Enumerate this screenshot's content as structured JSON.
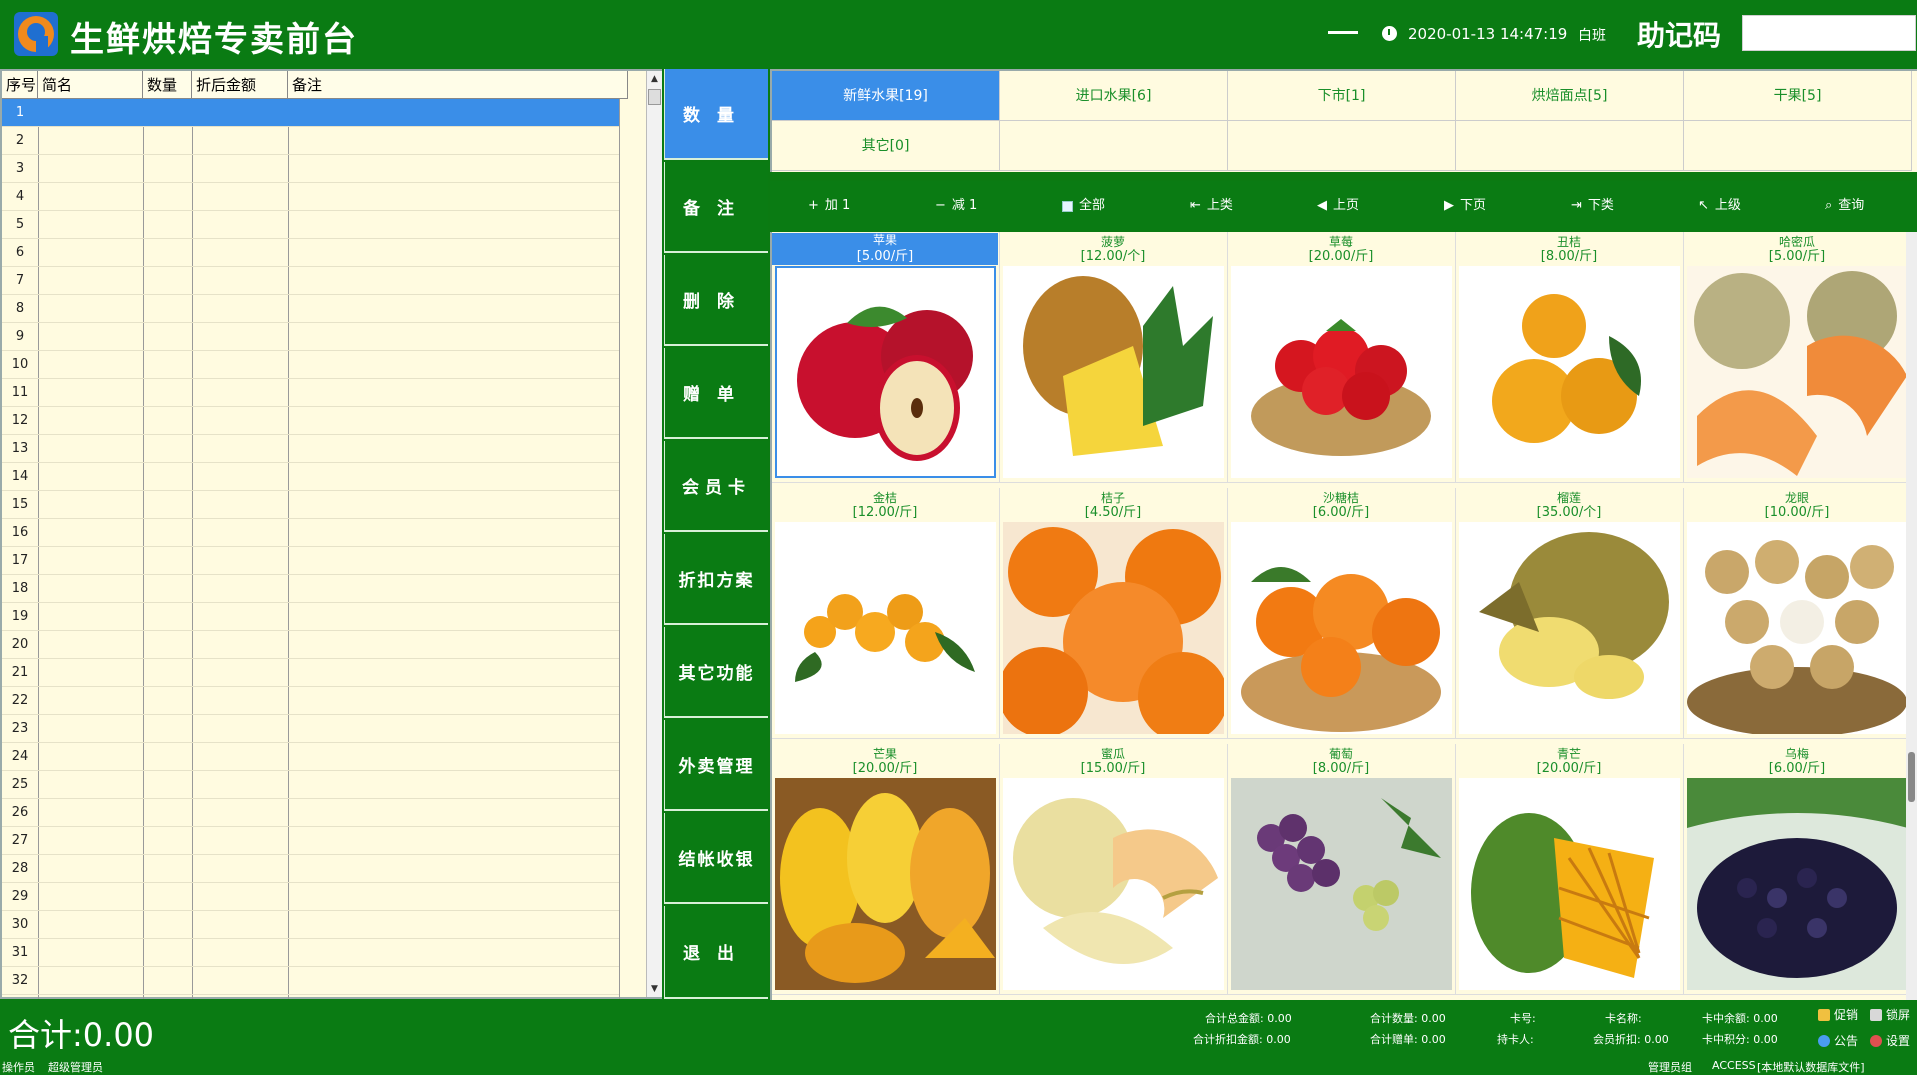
{
  "window": {
    "title": "生鲜烘焙专卖前台",
    "datetime": "2020-01-13 14:47:19",
    "shift": "白班",
    "mnemonic_label": "助记码",
    "mnemonic_value": ""
  },
  "order_table": {
    "columns": [
      "序号",
      "简名",
      "数量",
      "折后金额",
      "备注"
    ],
    "row_numbers": [
      "1",
      "2",
      "3",
      "4",
      "5",
      "6",
      "7",
      "8",
      "9",
      "10",
      "11",
      "12",
      "13",
      "14",
      "15",
      "16",
      "17",
      "18",
      "19",
      "20",
      "21",
      "22",
      "23",
      "24",
      "25",
      "26",
      "27",
      "28",
      "29",
      "30",
      "31",
      "32"
    ],
    "selected_row": 1
  },
  "function_buttons": [
    "数　量",
    "备　注",
    "删　除",
    "赠　单",
    "会员卡",
    "折扣方案",
    "其它功能",
    "外卖管理",
    "结帐收银",
    "退　出"
  ],
  "categories": [
    "新鲜水果[19]",
    "进口水果[6]",
    "下市[1]",
    "烘焙面点[5]",
    "干果[5]",
    "其它[0]"
  ],
  "selected_category": 0,
  "toolbar": [
    "加 1",
    "减 1",
    "全部",
    "上类",
    "上页",
    "下页",
    "下类",
    "上级",
    "查询"
  ],
  "products": [
    {
      "name": "苹果",
      "price": "[5.00/斤]",
      "icon": "apple"
    },
    {
      "name": "菠萝",
      "price": "[12.00/个]",
      "icon": "pineapple"
    },
    {
      "name": "草莓",
      "price": "[20.00/斤]",
      "icon": "strawberry"
    },
    {
      "name": "丑桔",
      "price": "[8.00/斤]",
      "icon": "ugli"
    },
    {
      "name": "哈密瓜",
      "price": "[5.00/斤]",
      "icon": "cantaloupe"
    },
    {
      "name": "金桔",
      "price": "[12.00/斤]",
      "icon": "kumquat"
    },
    {
      "name": "桔子",
      "price": "[4.50/斤]",
      "icon": "tangerine"
    },
    {
      "name": "沙糖桔",
      "price": "[6.00/斤]",
      "icon": "mandarin"
    },
    {
      "name": "榴莲",
      "price": "[35.00/个]",
      "icon": "durian"
    },
    {
      "name": "龙眼",
      "price": "[10.00/斤]",
      "icon": "longan"
    },
    {
      "name": "芒果",
      "price": "[20.00/斤]",
      "icon": "mango"
    },
    {
      "name": "蜜瓜",
      "price": "[15.00/斤]",
      "icon": "melon"
    },
    {
      "name": "葡萄",
      "price": "[8.00/斤]",
      "icon": "grape"
    },
    {
      "name": "青芒",
      "price": "[20.00/斤]",
      "icon": "green-mango"
    },
    {
      "name": "乌梅",
      "price": "[6.00/斤]",
      "icon": "plum"
    }
  ],
  "selected_product": 0,
  "summary": {
    "total_label": "合计:0.00",
    "total_amount_label": "合计总金额: 0.00",
    "discount_amount_label": "合计折扣金额: 0.00",
    "total_qty_label": "合计数量: 0.00",
    "gift_label": "合计赠单: 0.00",
    "card_no_label": "卡号:",
    "card_holder_label": "持卡人:",
    "card_name_label": "卡名称:",
    "member_discount_label": "会员折扣: 0.00",
    "card_balance_label": "卡中余额: 0.00",
    "card_points_label": "卡中积分: 0.00",
    "actions": [
      "促销",
      "锁屏",
      "公告",
      "设置"
    ]
  },
  "statusbar": {
    "operator_label": "操作员",
    "operator_name": "超级管理员",
    "group": "管理员组",
    "db": "ACCESS",
    "db_file": "[本地默认数据库文件]"
  },
  "colors": {
    "brand_green": "#0a7b13",
    "selection_blue": "#3a8ee8",
    "panel_bg": "#fffbe0",
    "text_green": "#1a8f2a"
  }
}
